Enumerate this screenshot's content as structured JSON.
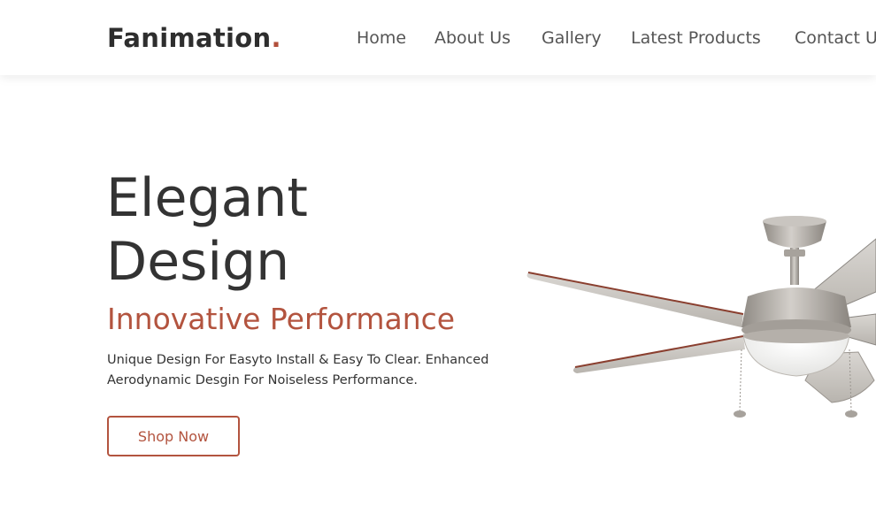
{
  "brand": {
    "name": "Fanimation",
    "dot": "."
  },
  "nav": {
    "links": [
      "Home",
      "About Us",
      "Gallery",
      "Latest Products",
      "Contact Us"
    ]
  },
  "hero": {
    "title_line1": "Elegant",
    "title_line2": "Design",
    "subtitle": "Innovative Performance",
    "description": "Unique Design For Easyto Install & Easy To Clear. Enhanced Aerodynamic Desgin For Noiseless Performance.",
    "button_label": "Shop Now",
    "image": "ceiling-fan"
  },
  "colors": {
    "accent": "#b3543f",
    "text_dark": "#333333",
    "nav_text": "#555555"
  }
}
